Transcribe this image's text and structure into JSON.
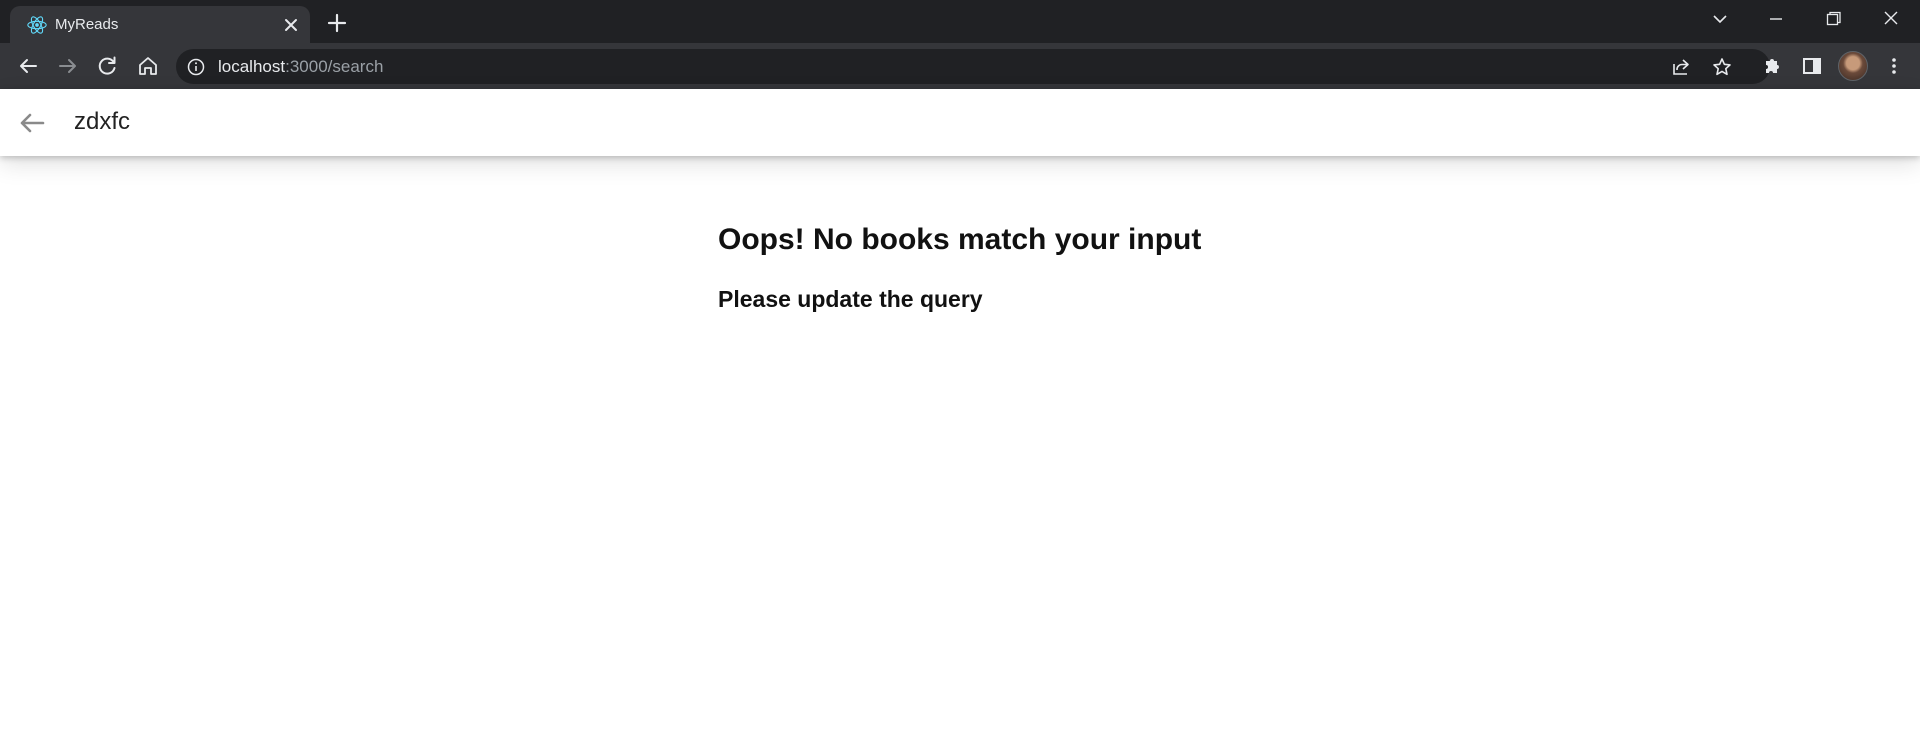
{
  "browser": {
    "tab": {
      "title": "MyReads",
      "favicon": "react-icon"
    },
    "address_bar": {
      "host": "localhost",
      "path": ":3000/search",
      "colors": {
        "host": "#e8eaed",
        "path": "#9aa0a6"
      }
    },
    "icons": [
      "tab-search-icon",
      "minimize-icon",
      "restore-icon",
      "close-window-icon",
      "back-icon",
      "forward-icon",
      "reload-icon",
      "home-icon",
      "info-icon",
      "share-icon",
      "star-icon",
      "extensions-icon",
      "side-panel-icon",
      "menu-icon"
    ]
  },
  "search": {
    "value": "zdxfc",
    "placeholder": ""
  },
  "results": {
    "heading": "Oops! No books match your input",
    "subheading": "Please update the query"
  },
  "colors": {
    "chrome_dark": "#202124",
    "chrome_toolbar": "#35363a",
    "page_background": "#ffffff",
    "react_accent": "#61dafb"
  }
}
